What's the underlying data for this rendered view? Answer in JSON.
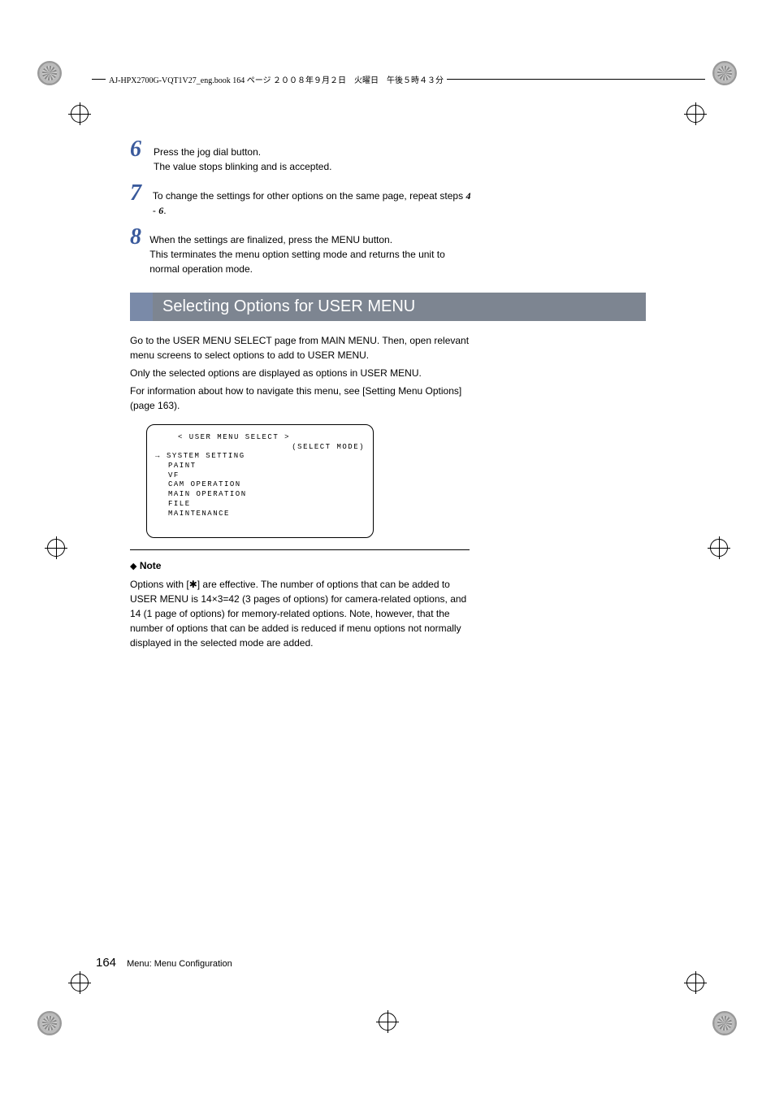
{
  "header": {
    "text": "AJ-HPX2700G-VQT1V27_eng.book  164 ページ  ２００８年９月２日　火曜日　午後５時４３分"
  },
  "steps": {
    "s6": {
      "num": "6",
      "line1": "Press the jog dial button.",
      "line2": "The value stops blinking and is accepted."
    },
    "s7": {
      "num": "7",
      "line1": "To change the settings for other options on the same page, repeat steps ",
      "range_a": "4",
      "dash": " - ",
      "range_b": "6",
      "period": "."
    },
    "s8": {
      "num": "8",
      "line1": "When the settings are finalized, press the MENU button.",
      "line2": "This terminates the menu option setting mode and returns the unit to normal operation mode."
    }
  },
  "section": {
    "title": "Selecting Options for USER MENU"
  },
  "intro": {
    "p1": "Go to the USER MENU SELECT page from MAIN MENU. Then, open relevant menu screens to select options to add to USER MENU.",
    "p2": "Only the selected options are displayed as options in USER MENU.",
    "p3": "For information about how to navigate this menu, see [Setting Menu Options] (page 163)."
  },
  "menu": {
    "title": "< USER MENU SELECT >",
    "mode": "(SELECT MODE)",
    "items": [
      "SYSTEM SETTING",
      "PAINT",
      "VF",
      "CAM OPERATION",
      "MAIN OPERATION",
      "FILE",
      "MAINTENANCE"
    ]
  },
  "note": {
    "marker": "◆",
    "label": "Note",
    "body": "Options with [✱] are effective. The number of options that can be added to USER MENU is 14×3=42 (3 pages of options) for camera-related options, and 14 (1 page of options) for memory-related options. Note, however, that the number of options that can be added is reduced if menu options not normally displayed in the selected mode are added."
  },
  "footer": {
    "page": "164",
    "label": "Menu: Menu Configuration"
  }
}
